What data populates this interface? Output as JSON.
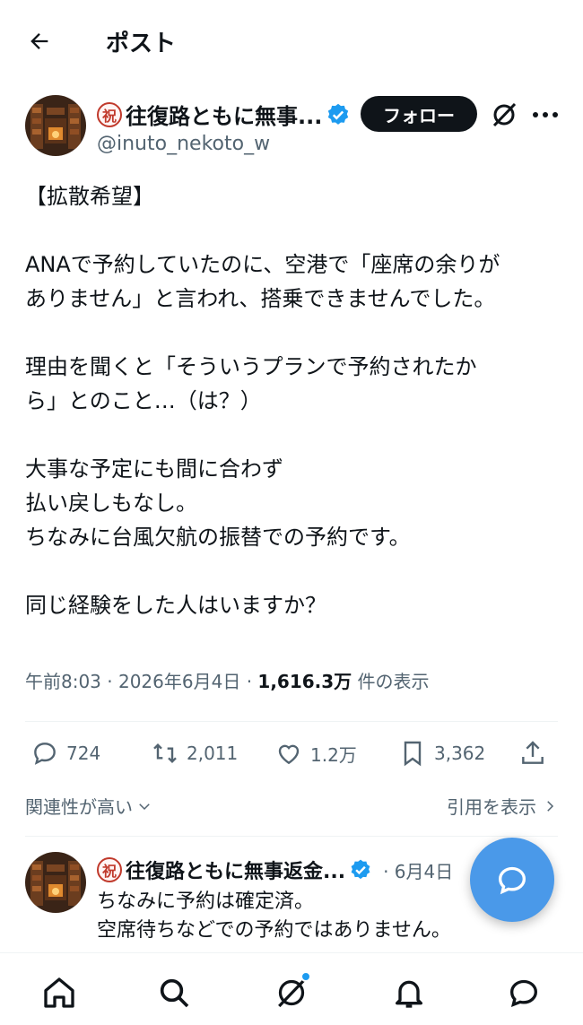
{
  "header": {
    "title": "ポスト"
  },
  "author": {
    "badge": "祝",
    "name": "往復路ともに無事...",
    "handle": "@inuto_nekoto_w",
    "follow_label": "フォロー"
  },
  "post": {
    "lines": [
      "【拡散希望】",
      "",
      "ANAで予約していたのに、空港で「座席の余りが",
      "ありません」と言われ、搭乗できませんでした。",
      "",
      "理由を聞くと「そういうプランで予約されたか",
      "ら」とのこと…（は？）",
      "",
      "大事な予定にも間に合わず",
      "払い戻しもなし。",
      "ちなみに台風欠航の振替での予約です。",
      "",
      "同じ経験をした人はいますか？"
    ],
    "time": "午前8:03 · 2026年6月4日 · ",
    "views_count": "1,616.3万",
    "views_label": " 件の表示"
  },
  "actions": {
    "replies": "724",
    "reposts": "2,011",
    "likes": "1.2万",
    "bookmarks": "3,362"
  },
  "links": {
    "related": "関連性が高い",
    "quotes": "引用を表示"
  },
  "reply": {
    "badge": "祝",
    "name": "往復路ともに無事返金...",
    "date": "· 6月4日",
    "lines": [
      "ちなみに予約は確定済。",
      "空席待ちなどでの予約ではありません。"
    ]
  },
  "colors": {
    "accent": "#1d9bf0",
    "fab": "#4a99e9",
    "text": "#0f1419",
    "secondary": "#536471"
  },
  "icons": [
    "back-arrow-icon",
    "verified-badge-icon",
    "grok-icon",
    "more-icon",
    "reply-icon",
    "repost-icon",
    "like-icon",
    "bookmark-icon",
    "share-icon",
    "chevron-down-icon",
    "chevron-right-icon",
    "compose-reply-icon",
    "home-icon",
    "search-icon",
    "grok-nav-icon",
    "notifications-icon",
    "messages-icon"
  ]
}
